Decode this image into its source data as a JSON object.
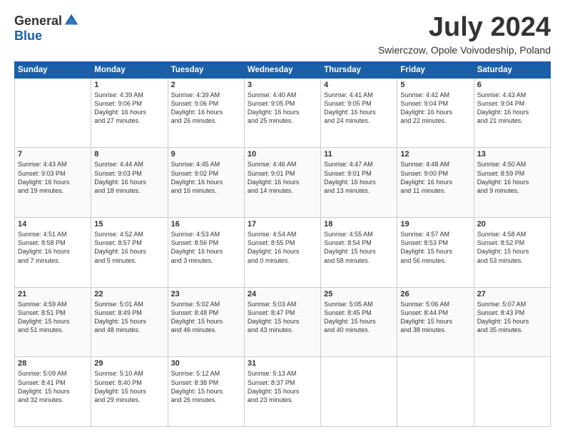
{
  "header": {
    "logo_general": "General",
    "logo_blue": "Blue",
    "month": "July 2024",
    "location": "Swierczow, Opole Voivodeship, Poland"
  },
  "weekdays": [
    "Sunday",
    "Monday",
    "Tuesday",
    "Wednesday",
    "Thursday",
    "Friday",
    "Saturday"
  ],
  "weeks": [
    [
      {
        "day": "",
        "text": ""
      },
      {
        "day": "1",
        "text": "Sunrise: 4:39 AM\nSunset: 9:06 PM\nDaylight: 16 hours\nand 27 minutes."
      },
      {
        "day": "2",
        "text": "Sunrise: 4:39 AM\nSunset: 9:06 PM\nDaylight: 16 hours\nand 26 minutes."
      },
      {
        "day": "3",
        "text": "Sunrise: 4:40 AM\nSunset: 9:05 PM\nDaylight: 16 hours\nand 25 minutes."
      },
      {
        "day": "4",
        "text": "Sunrise: 4:41 AM\nSunset: 9:05 PM\nDaylight: 16 hours\nand 24 minutes."
      },
      {
        "day": "5",
        "text": "Sunrise: 4:42 AM\nSunset: 9:04 PM\nDaylight: 16 hours\nand 22 minutes."
      },
      {
        "day": "6",
        "text": "Sunrise: 4:43 AM\nSunset: 9:04 PM\nDaylight: 16 hours\nand 21 minutes."
      }
    ],
    [
      {
        "day": "7",
        "text": "Sunrise: 4:43 AM\nSunset: 9:03 PM\nDaylight: 16 hours\nand 19 minutes."
      },
      {
        "day": "8",
        "text": "Sunrise: 4:44 AM\nSunset: 9:03 PM\nDaylight: 16 hours\nand 18 minutes."
      },
      {
        "day": "9",
        "text": "Sunrise: 4:45 AM\nSunset: 9:02 PM\nDaylight: 16 hours\nand 16 minutes."
      },
      {
        "day": "10",
        "text": "Sunrise: 4:46 AM\nSunset: 9:01 PM\nDaylight: 16 hours\nand 14 minutes."
      },
      {
        "day": "11",
        "text": "Sunrise: 4:47 AM\nSunset: 9:01 PM\nDaylight: 16 hours\nand 13 minutes."
      },
      {
        "day": "12",
        "text": "Sunrise: 4:48 AM\nSunset: 9:00 PM\nDaylight: 16 hours\nand 11 minutes."
      },
      {
        "day": "13",
        "text": "Sunrise: 4:50 AM\nSunset: 8:59 PM\nDaylight: 16 hours\nand 9 minutes."
      }
    ],
    [
      {
        "day": "14",
        "text": "Sunrise: 4:51 AM\nSunset: 8:58 PM\nDaylight: 16 hours\nand 7 minutes."
      },
      {
        "day": "15",
        "text": "Sunrise: 4:52 AM\nSunset: 8:57 PM\nDaylight: 16 hours\nand 5 minutes."
      },
      {
        "day": "16",
        "text": "Sunrise: 4:53 AM\nSunset: 8:56 PM\nDaylight: 16 hours\nand 3 minutes."
      },
      {
        "day": "17",
        "text": "Sunrise: 4:54 AM\nSunset: 8:55 PM\nDaylight: 16 hours\nand 0 minutes."
      },
      {
        "day": "18",
        "text": "Sunrise: 4:55 AM\nSunset: 8:54 PM\nDaylight: 15 hours\nand 58 minutes."
      },
      {
        "day": "19",
        "text": "Sunrise: 4:57 AM\nSunset: 8:53 PM\nDaylight: 15 hours\nand 56 minutes."
      },
      {
        "day": "20",
        "text": "Sunrise: 4:58 AM\nSunset: 8:52 PM\nDaylight: 15 hours\nand 53 minutes."
      }
    ],
    [
      {
        "day": "21",
        "text": "Sunrise: 4:59 AM\nSunset: 8:51 PM\nDaylight: 15 hours\nand 51 minutes."
      },
      {
        "day": "22",
        "text": "Sunrise: 5:01 AM\nSunset: 8:49 PM\nDaylight: 15 hours\nand 48 minutes."
      },
      {
        "day": "23",
        "text": "Sunrise: 5:02 AM\nSunset: 8:48 PM\nDaylight: 15 hours\nand 46 minutes."
      },
      {
        "day": "24",
        "text": "Sunrise: 5:03 AM\nSunset: 8:47 PM\nDaylight: 15 hours\nand 43 minutes."
      },
      {
        "day": "25",
        "text": "Sunrise: 5:05 AM\nSunset: 8:45 PM\nDaylight: 15 hours\nand 40 minutes."
      },
      {
        "day": "26",
        "text": "Sunrise: 5:06 AM\nSunset: 8:44 PM\nDaylight: 15 hours\nand 38 minutes."
      },
      {
        "day": "27",
        "text": "Sunrise: 5:07 AM\nSunset: 8:43 PM\nDaylight: 15 hours\nand 35 minutes."
      }
    ],
    [
      {
        "day": "28",
        "text": "Sunrise: 5:09 AM\nSunset: 8:41 PM\nDaylight: 15 hours\nand 32 minutes."
      },
      {
        "day": "29",
        "text": "Sunrise: 5:10 AM\nSunset: 8:40 PM\nDaylight: 15 hours\nand 29 minutes."
      },
      {
        "day": "30",
        "text": "Sunrise: 5:12 AM\nSunset: 8:38 PM\nDaylight: 15 hours\nand 26 minutes."
      },
      {
        "day": "31",
        "text": "Sunrise: 5:13 AM\nSunset: 8:37 PM\nDaylight: 15 hours\nand 23 minutes."
      },
      {
        "day": "",
        "text": ""
      },
      {
        "day": "",
        "text": ""
      },
      {
        "day": "",
        "text": ""
      }
    ]
  ]
}
